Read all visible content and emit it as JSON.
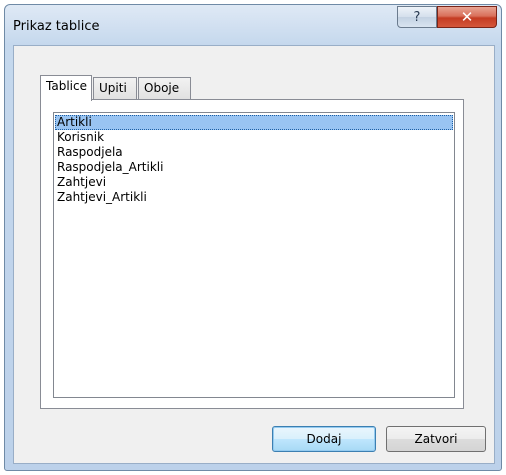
{
  "window": {
    "title": "Prikaz tablice",
    "help_glyph": "?",
    "close_glyph": "✕"
  },
  "tabs": [
    {
      "label": "Tablice",
      "active": true
    },
    {
      "label": "Upiti",
      "active": false
    },
    {
      "label": "Oboje",
      "active": false
    }
  ],
  "list": {
    "items": [
      "Artikli",
      "Korisnik",
      "Raspodjela",
      "Raspodjela_Artikli",
      "Zahtjevi",
      "Zahtjevi_Artikli"
    ],
    "selected_index": 0
  },
  "buttons": {
    "add": "Dodaj",
    "close": "Zatvori"
  },
  "colors": {
    "selection": "#99c4f2",
    "close_button": "#c43c23"
  }
}
